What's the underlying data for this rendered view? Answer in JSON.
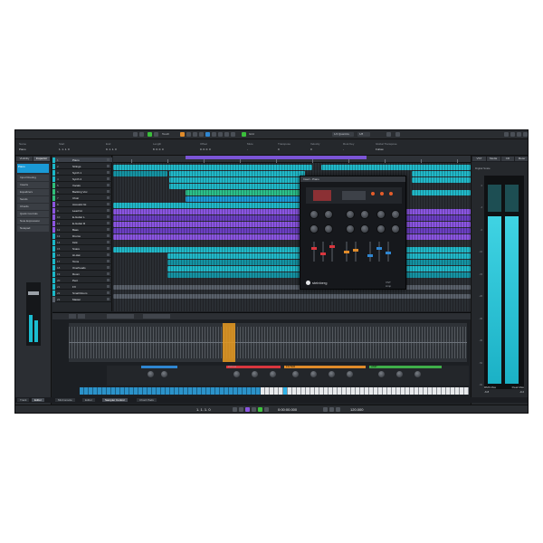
{
  "app": {
    "title": "Cubase",
    "toolbar": {
      "left_label": "Touch",
      "mid_label": "Grid",
      "quantize_label": "1/4 Quantize",
      "right_label": "1/8"
    },
    "info_line": [
      {
        "k": "Name",
        "v": "Piano"
      },
      {
        "k": "Start",
        "v": "1. 1. 1. 0"
      },
      {
        "k": "End",
        "v": "9. 1. 1. 0"
      },
      {
        "k": "Length",
        "v": "8. 0. 0. 0"
      },
      {
        "k": "Offset",
        "v": "0. 0. 0. 0"
      },
      {
        "k": "Mute",
        "v": "-"
      },
      {
        "k": "Transpose",
        "v": "0"
      },
      {
        "k": "Velocity",
        "v": "0"
      },
      {
        "k": "Root Key",
        "v": "-"
      },
      {
        "k": "Global Transpose",
        "v": "Follow"
      }
    ]
  },
  "inspector": {
    "tabs": [
      "Visibility",
      "Inspector"
    ],
    "track_name": "Piano",
    "sections": [
      "Input Routing",
      "Inserts",
      "Equalizers",
      "Sends",
      "Chords",
      "Quick Controls",
      "Note Expression",
      "Notepad"
    ]
  },
  "tracks": [
    {
      "num": "1",
      "name": "Piano",
      "color": "#1bb8c8"
    },
    {
      "num": "2",
      "name": "Strings",
      "color": "#1bb8c8"
    },
    {
      "num": "3",
      "name": "Synth 1",
      "color": "#1bb8c8"
    },
    {
      "num": "4",
      "name": "Synth 2",
      "color": "#1bb8c8"
    },
    {
      "num": "5",
      "name": "Vocals",
      "color": "#2fbf7a"
    },
    {
      "num": "6",
      "name": "Backing Vox",
      "color": "#2fbf7a"
    },
    {
      "num": "7",
      "name": "Choir",
      "color": "#2fbf7a"
    },
    {
      "num": "8",
      "name": "Acoustic Gt",
      "color": "#8a55e0"
    },
    {
      "num": "9",
      "name": "Lead Gt",
      "color": "#8a55e0"
    },
    {
      "num": "10",
      "name": "E-Guitar L",
      "color": "#8a55e0"
    },
    {
      "num": "11",
      "name": "E-Guitar R",
      "color": "#8a55e0"
    },
    {
      "num": "12",
      "name": "Bass",
      "color": "#8a55e0"
    },
    {
      "num": "13",
      "name": "Drums",
      "color": "#1bb8c8"
    },
    {
      "num": "14",
      "name": "Kick",
      "color": "#1bb8c8"
    },
    {
      "num": "15",
      "name": "Snare",
      "color": "#1bb8c8"
    },
    {
      "num": "16",
      "name": "Hi-Hat",
      "color": "#1bb8c8"
    },
    {
      "num": "17",
      "name": "Toms",
      "color": "#1bb8c8"
    },
    {
      "num": "18",
      "name": "Overheads",
      "color": "#1bb8c8"
    },
    {
      "num": "19",
      "name": "Room",
      "color": "#1bb8c8"
    },
    {
      "num": "20",
      "name": "Perc",
      "color": "#1bb8c8"
    },
    {
      "num": "21",
      "name": "FX",
      "color": "#1bb8c8"
    },
    {
      "num": "22",
      "name": "Small Room",
      "color": "#1bb8c8"
    },
    {
      "num": "23",
      "name": "Master",
      "color": "#59606a"
    }
  ],
  "plugin": {
    "title": "Insert - Piano",
    "brand": "steinberg",
    "product": "VST Amp"
  },
  "right_panel": {
    "tabs": [
      "VST",
      "Media",
      "CR",
      "Meter"
    ],
    "label": "Digital Scale",
    "scale": [
      "0",
      "-3",
      "-6",
      "-10",
      "-15",
      "-20",
      "-30",
      "-40",
      "-50",
      "-60"
    ],
    "values": {
      "rms": "RMS Max",
      "rms_val": "-6.8",
      "peak": "Peak Max",
      "peak_val": "-0.2"
    }
  },
  "lower_zone": {
    "sampler_sections": [
      "PITCH",
      "FILTER",
      "AMP"
    ],
    "section_colors": [
      "#2f86d1",
      "#d9363e",
      "#e08b2a",
      "#3fae49"
    ]
  },
  "bottom_tabs": [
    "Track",
    "Editor",
    "MixConsole",
    "Editor",
    "Sampler Control",
    "Chord Pads"
  ],
  "transport": {
    "left_time": "1. 1. 1. 0",
    "position": "0:00:00.000",
    "tempo": "120.000"
  }
}
